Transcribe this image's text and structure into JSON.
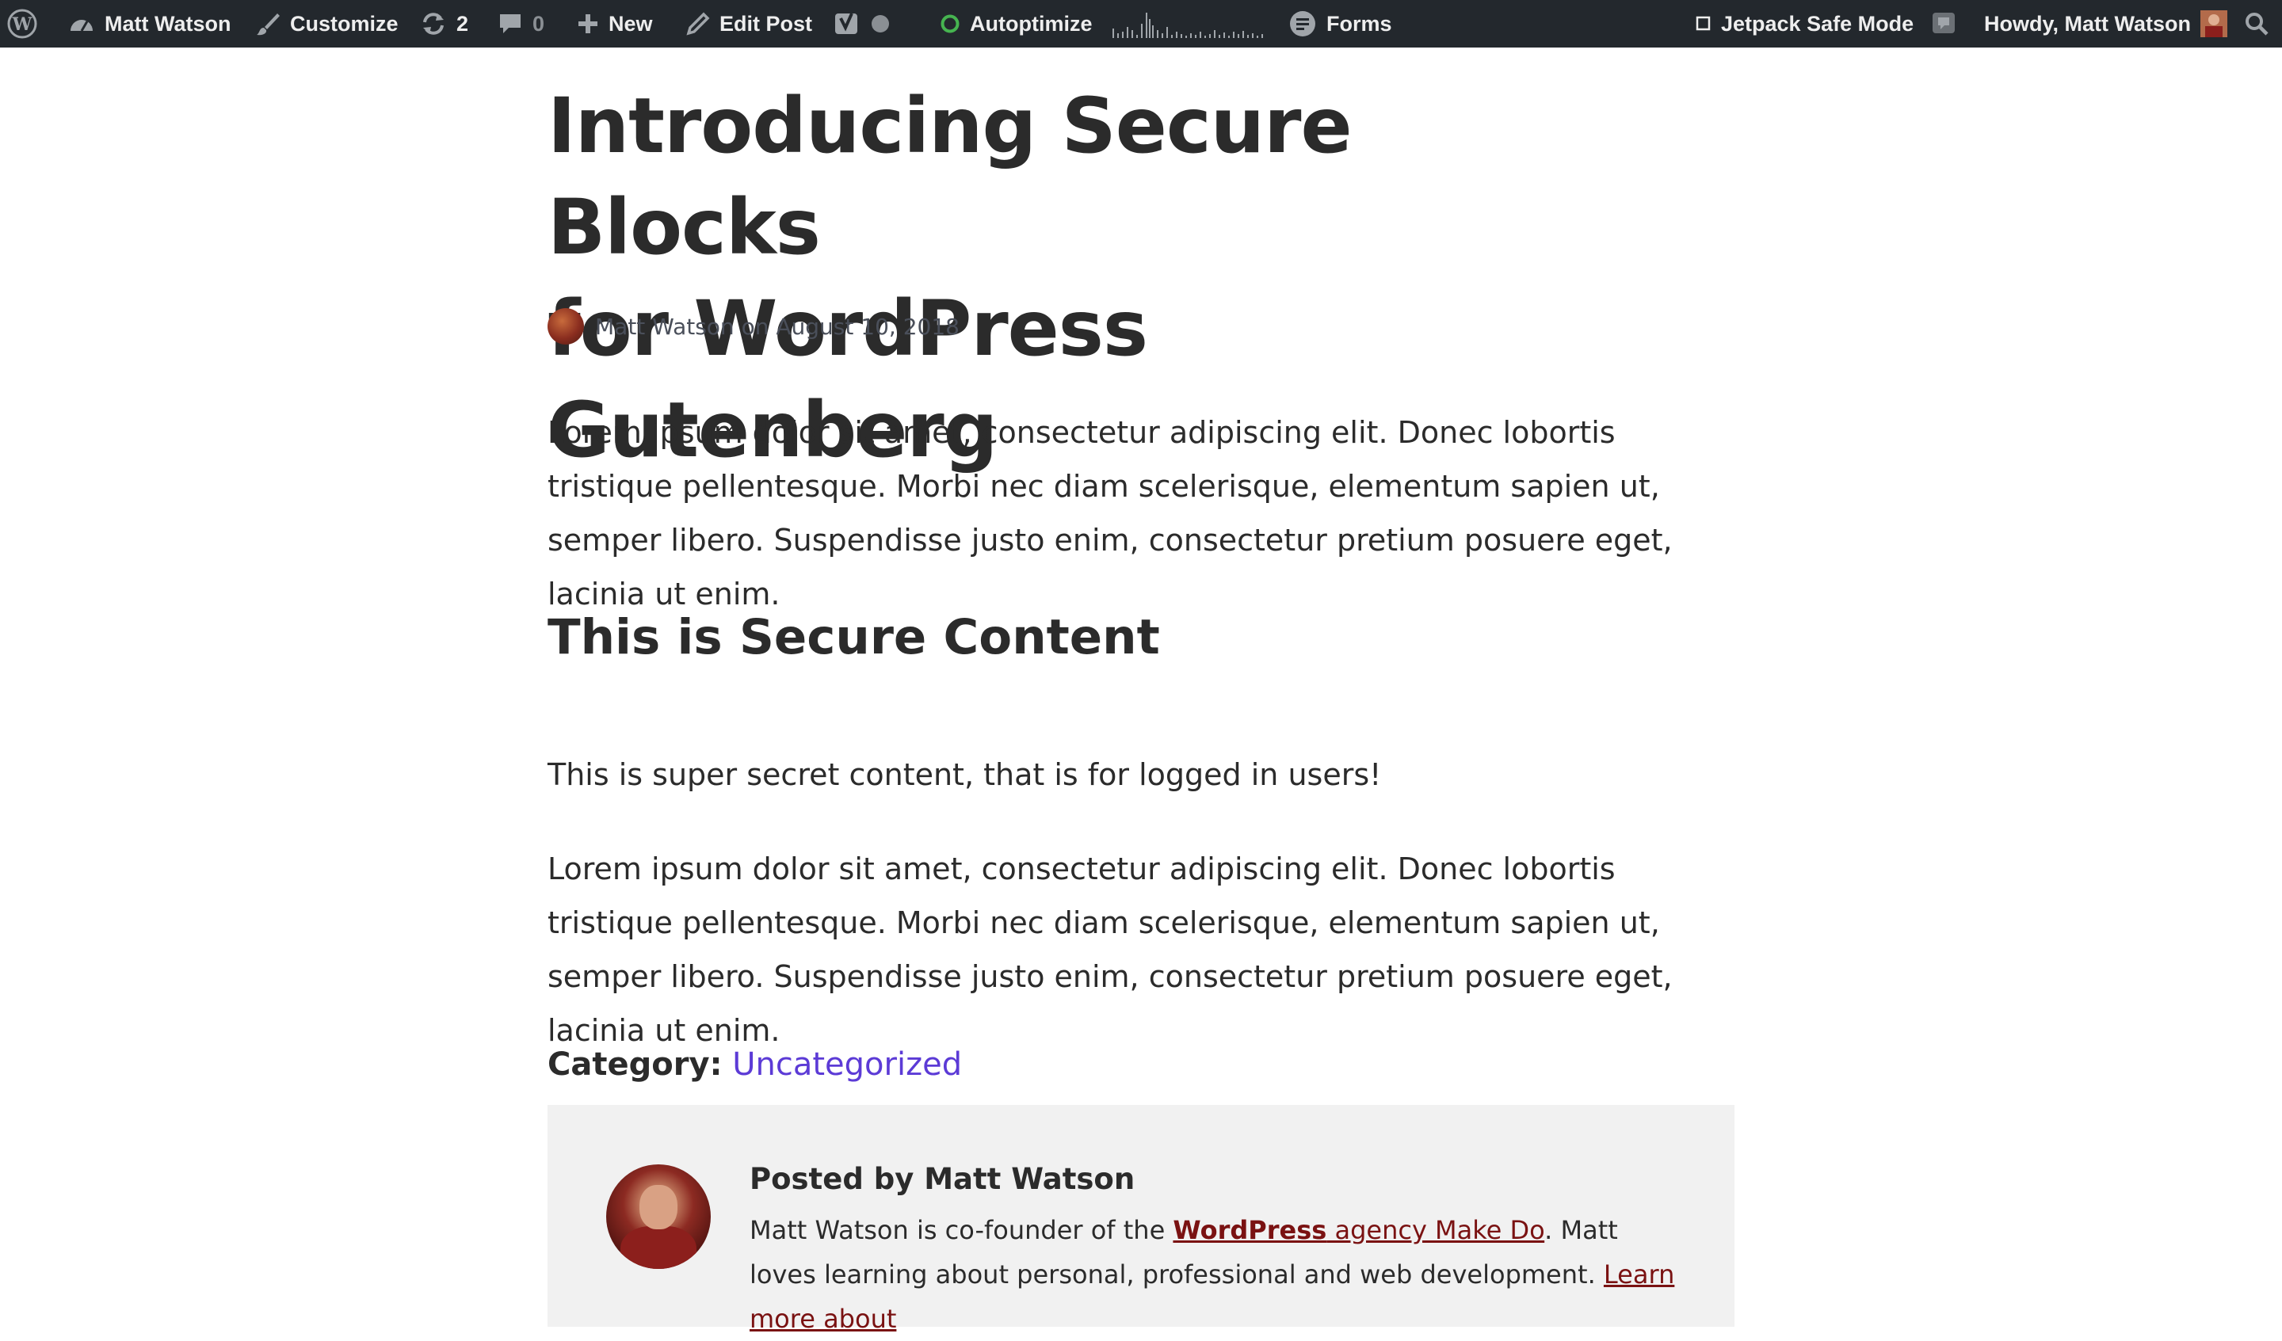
{
  "adminbar": {
    "site_name": "Matt Watson",
    "customize": "Customize",
    "updates_count": "2",
    "comments_count": "0",
    "new_label": "New",
    "edit_post": "Edit Post",
    "autoptimize": "Autoptimize",
    "forms": "Forms",
    "jetpack": "Jetpack Safe Mode",
    "howdy": "Howdy, Matt Watson",
    "colors": {
      "background": "#23282d",
      "text": "#eeeeee",
      "status_ok": "#46b450"
    }
  },
  "post": {
    "title_line_1": "Introducing Secure Blocks",
    "title_line_2": "for WordPress Gutenberg",
    "author": "Matt Watson",
    "date_prefix": "on",
    "date": "August 10, 2018",
    "paragraph_1": "Lorem ipsum dolor sit amet, consectetur adipiscing elit. Donec lobortis tristique pellentesque. Morbi nec diam scelerisque, elementum sapien ut, semper libero. Suspendisse justo enim, consectetur pretium posuere eget, lacinia ut enim.",
    "heading": "This is Secure Content",
    "secret_line": "This is super secret content, that is for logged in users!",
    "paragraph_2": "Lorem ipsum dolor sit amet, consectetur adipiscing elit. Donec lobortis tristique pellentesque. Morbi nec diam scelerisque, elementum sapien ut, semper libero. Suspendisse justo enim, consectetur pretium posuere eget, lacinia ut enim.",
    "category_label": "Category:",
    "category_value": "Uncategorized",
    "link_color": "#5c3bd6"
  },
  "author_box": {
    "posted_by": "Posted by Matt Watson",
    "bio_prefix": "Matt Watson is co-founder of the ",
    "bio_brand": "WordPress",
    "bio_agency": " agency Make Do",
    "bio_mid": ". Matt loves learning about personal, professional and web development. ",
    "bio_learn_more": "Learn more about",
    "background": "#f1f1f1",
    "brand_color": "#7a1212"
  },
  "icons": [
    "wordpress-logo-icon",
    "dashboard-icon",
    "brush-icon",
    "updates-icon",
    "comment-icon",
    "plus-icon",
    "pencil-icon",
    "yoast-icon",
    "status-dot-icon",
    "forms-icon",
    "search-icon"
  ]
}
